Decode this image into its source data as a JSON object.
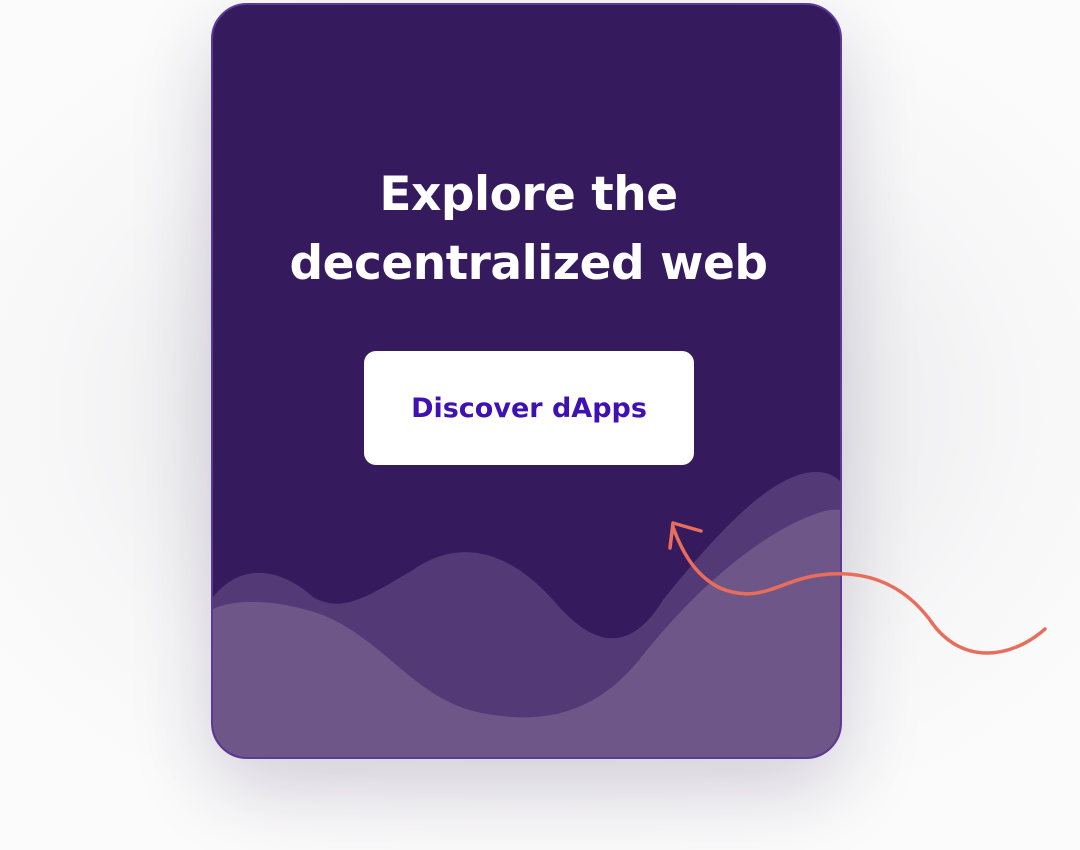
{
  "card": {
    "title_line1": "Explore the",
    "title_line2": "decentralized web",
    "button_label": "Discover dApps"
  },
  "colors": {
    "card_background": "#351a5e",
    "card_border": "#5a3a97",
    "wave_back": "#533a77",
    "wave_front": "#6e5788",
    "button_background": "#ffffff",
    "button_text": "#3f10b2",
    "arrow": "#e86d5a"
  },
  "icons": {
    "decoration": "wave-shapes",
    "pointer": "curly-arrow-icon"
  }
}
